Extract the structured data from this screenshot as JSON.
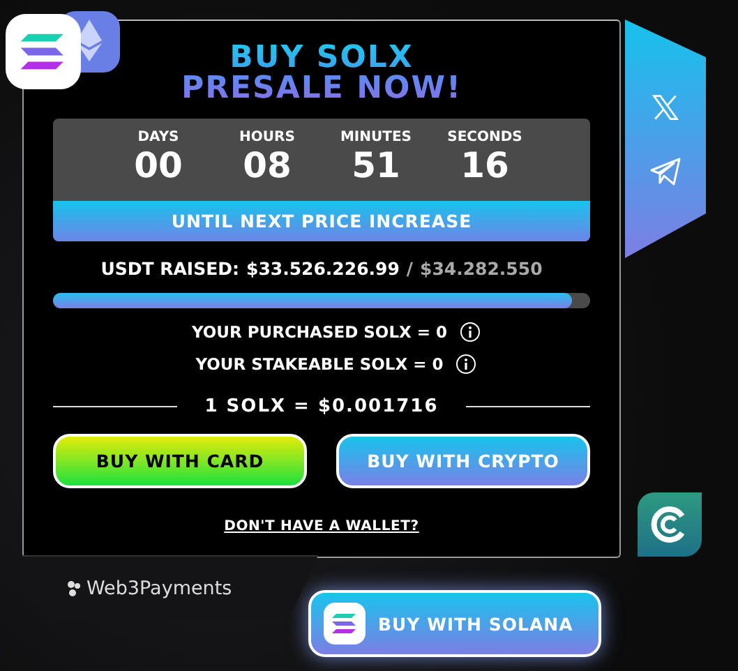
{
  "title": {
    "line1": "BUY SOLX",
    "line2": "PRESALE NOW!"
  },
  "countdown": [
    {
      "label": "DAYS",
      "value": "00"
    },
    {
      "label": "HOURS",
      "value": "08"
    },
    {
      "label": "MINUTES",
      "value": "51"
    },
    {
      "label": "SECONDS",
      "value": "16"
    }
  ],
  "countdown_caption": "UNTIL NEXT PRICE INCREASE",
  "raised": {
    "label": "USDT RAISED:",
    "amount": "$33.526.226.99",
    "separator": "/",
    "target": "$34.282.550",
    "level": 0.965
  },
  "balances": [
    {
      "label": "YOUR PURCHASED SOLX = 0"
    },
    {
      "label": "YOUR STAKEABLE SOLX = 0"
    }
  ],
  "price": "1 SOLX = $0.001716",
  "buttons": [
    {
      "label": "BUY WITH CARD",
      "kind": "card"
    },
    {
      "label": "BUY WITH CRYPTO",
      "kind": "crypto"
    }
  ],
  "wallet_link": "DON'T HAVE A WALLET?",
  "footer_brand": "Web3Payments",
  "solana_button": "BUY WITH SOLANA"
}
